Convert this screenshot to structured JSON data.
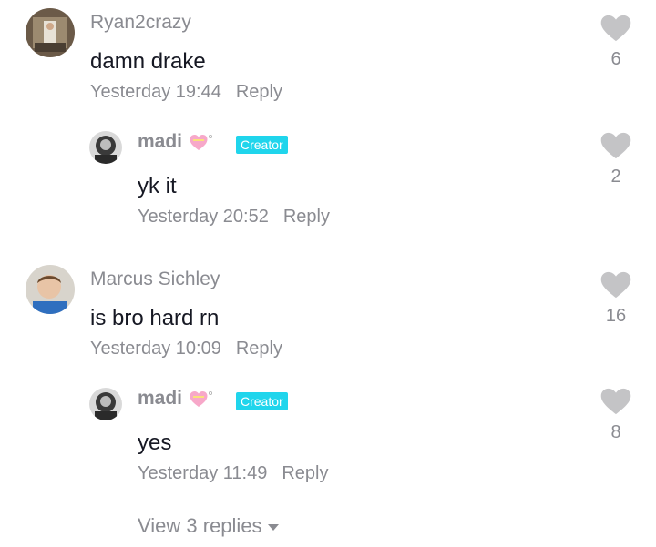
{
  "colors": {
    "creator_badge": "#20d5ec",
    "muted_text": "#8a8b91",
    "main_text": "#161823",
    "like_icon": "#c4c4c6"
  },
  "comments": [
    {
      "username": "Ryan2crazy",
      "text": "damn drake",
      "time": "Yesterday 19:44",
      "reply_label": "Reply",
      "likes": "6",
      "reply": {
        "username": "madi",
        "badge": "Creator",
        "text": "yk it",
        "time": "Yesterday 20:52",
        "reply_label": "Reply",
        "likes": "2"
      }
    },
    {
      "username": "Marcus Sichley",
      "text": "is bro hard rn",
      "time": "Yesterday 10:09",
      "reply_label": "Reply",
      "likes": "16",
      "reply": {
        "username": "madi",
        "badge": "Creator",
        "text": "yes",
        "time": "Yesterday 11:49",
        "reply_label": "Reply",
        "likes": "8"
      }
    }
  ],
  "view_replies": "View 3 replies"
}
